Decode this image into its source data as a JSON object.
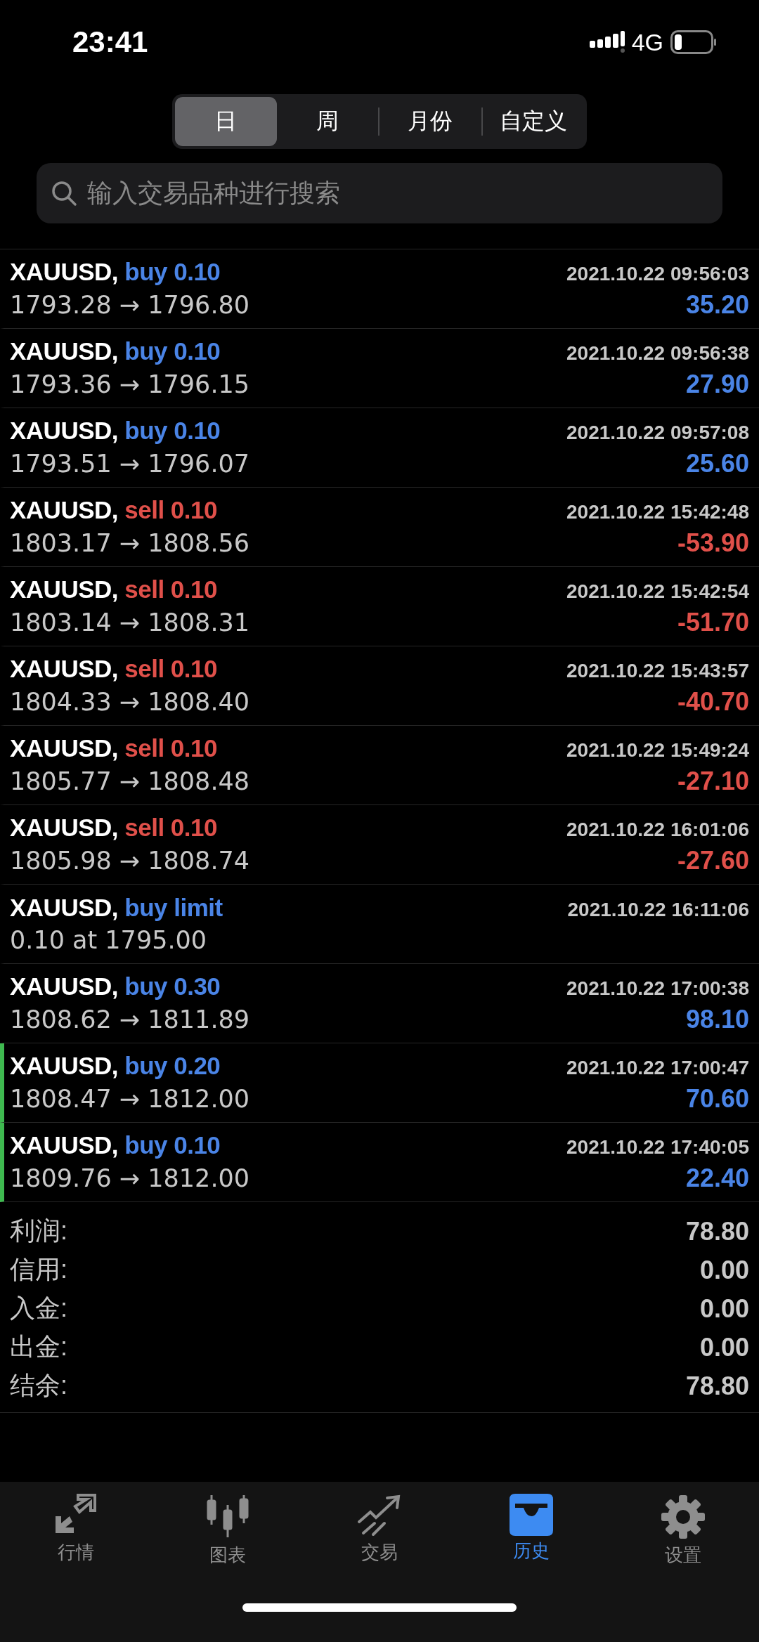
{
  "status_bar": {
    "time": "23:41",
    "network": "4G"
  },
  "period_tabs": [
    {
      "label": "日",
      "selected": true
    },
    {
      "label": "周",
      "selected": false
    },
    {
      "label": "月份",
      "selected": false
    },
    {
      "label": "自定义",
      "selected": false
    }
  ],
  "search": {
    "placeholder": "输入交易品种进行搜索"
  },
  "deals": [
    {
      "symbol": "XAUUSD,",
      "kind": "buy",
      "action": "buy 0.10",
      "time": "2021.10.22 09:56:03",
      "prices": "1793.28 → 1796.80",
      "profit": "35.20",
      "marked": false
    },
    {
      "symbol": "XAUUSD,",
      "kind": "buy",
      "action": "buy 0.10",
      "time": "2021.10.22 09:56:38",
      "prices": "1793.36 → 1796.15",
      "profit": "27.90",
      "marked": false
    },
    {
      "symbol": "XAUUSD,",
      "kind": "buy",
      "action": "buy 0.10",
      "time": "2021.10.22 09:57:08",
      "prices": "1793.51 → 1796.07",
      "profit": "25.60",
      "marked": false
    },
    {
      "symbol": "XAUUSD,",
      "kind": "sell",
      "action": "sell 0.10",
      "time": "2021.10.22 15:42:48",
      "prices": "1803.17 → 1808.56",
      "profit": "-53.90",
      "marked": false
    },
    {
      "symbol": "XAUUSD,",
      "kind": "sell",
      "action": "sell 0.10",
      "time": "2021.10.22 15:42:54",
      "prices": "1803.14 → 1808.31",
      "profit": "-51.70",
      "marked": false
    },
    {
      "symbol": "XAUUSD,",
      "kind": "sell",
      "action": "sell 0.10",
      "time": "2021.10.22 15:43:57",
      "prices": "1804.33 → 1808.40",
      "profit": "-40.70",
      "marked": false
    },
    {
      "symbol": "XAUUSD,",
      "kind": "sell",
      "action": "sell 0.10",
      "time": "2021.10.22 15:49:24",
      "prices": "1805.77 → 1808.48",
      "profit": "-27.10",
      "marked": false
    },
    {
      "symbol": "XAUUSD,",
      "kind": "sell",
      "action": "sell 0.10",
      "time": "2021.10.22 16:01:06",
      "prices": "1805.98 → 1808.74",
      "profit": "-27.60",
      "marked": false
    },
    {
      "symbol": "XAUUSD,",
      "kind": "buy",
      "action": "buy limit",
      "time": "2021.10.22 16:11:06",
      "prices": "0.10 at 1795.00",
      "marked": false
    },
    {
      "symbol": "XAUUSD,",
      "kind": "buy",
      "action": "buy 0.30",
      "time": "2021.10.22 17:00:38",
      "prices": "1808.62 → 1811.89",
      "profit": "98.10",
      "marked": false
    },
    {
      "symbol": "XAUUSD,",
      "kind": "buy",
      "action": "buy 0.20",
      "time": "2021.10.22 17:00:47",
      "prices": "1808.47 → 1812.00",
      "profit": "70.60",
      "marked": true
    },
    {
      "symbol": "XAUUSD,",
      "kind": "buy",
      "action": "buy 0.10",
      "time": "2021.10.22 17:40:05",
      "prices": "1809.76 → 1812.00",
      "profit": "22.40",
      "marked": true
    }
  ],
  "summary": [
    {
      "label": "利润:",
      "value": "78.80"
    },
    {
      "label": "信用:",
      "value": "0.00"
    },
    {
      "label": "入金:",
      "value": "0.00"
    },
    {
      "label": "出金:",
      "value": "0.00"
    },
    {
      "label": "结余:",
      "value": "78.80"
    }
  ],
  "tab_bar": [
    {
      "kind": "quotes",
      "label": "行情",
      "selected": false
    },
    {
      "kind": "chart",
      "label": "图表",
      "selected": false
    },
    {
      "kind": "trade",
      "label": "交易",
      "selected": false
    },
    {
      "kind": "history",
      "label": "历史",
      "selected": true
    },
    {
      "kind": "settings",
      "label": "设置",
      "selected": false
    }
  ]
}
